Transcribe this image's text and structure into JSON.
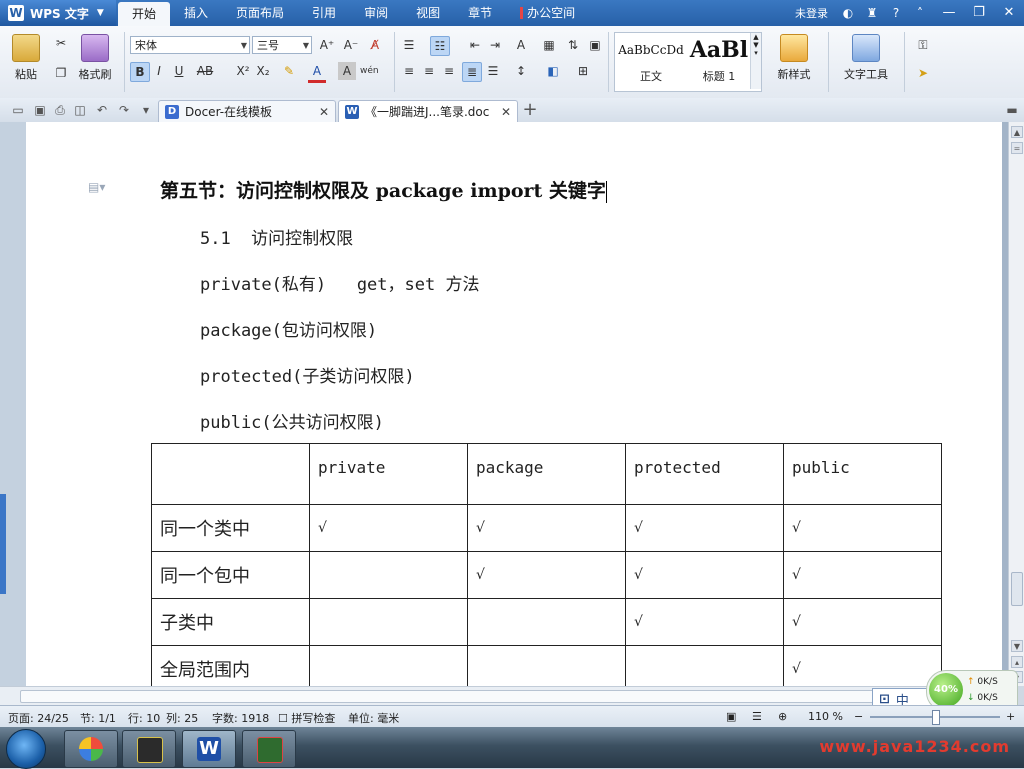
{
  "titlebar": {
    "app_name": "WPS 文字",
    "menu_tabs": [
      "开始",
      "插入",
      "页面布局",
      "引用",
      "审阅",
      "视图",
      "章节",
      "办公空间"
    ],
    "login": "未登录"
  },
  "ribbon": {
    "paste_label": "粘贴",
    "format_painter_label": "格式刷",
    "font_name": "宋体",
    "font_size": "三号",
    "styles": [
      {
        "preview": "AaBbCcDd",
        "name": "正文"
      },
      {
        "preview": "AaBl",
        "name": "标题 1"
      }
    ],
    "new_style_label": "新样式",
    "text_tools_label": "文字工具"
  },
  "tabs": [
    {
      "label": "Docer-在线模板"
    },
    {
      "label": "《一脚踹进J...笔录.doc"
    }
  ],
  "document": {
    "heading": "第五节：访问控制权限及 package import 关键字",
    "lines": [
      "5.1  访问控制权限",
      "private(私有)   get，set 方法",
      "package(包访问权限)",
      "protected(子类访问权限)",
      "public(公共访问权限)"
    ],
    "table": {
      "headers": [
        "",
        "private",
        "package",
        "protected",
        "public"
      ],
      "rows": [
        {
          "label": "同一个类中",
          "cells": [
            "√",
            "√",
            "√",
            "√"
          ]
        },
        {
          "label": "同一个包中",
          "cells": [
            "",
            "√",
            "√",
            "√"
          ]
        },
        {
          "label": "子类中",
          "cells": [
            "",
            "",
            "√",
            "√"
          ]
        },
        {
          "label": "全局范围内",
          "cells": [
            "",
            "",
            "",
            "√"
          ]
        }
      ]
    }
  },
  "widgets": {
    "ime_label": "中",
    "net_percent": "40%",
    "net_up": "0K/S",
    "net_down": "0K/S"
  },
  "statusbar": {
    "page": "页面: 24/25",
    "section": "节: 1/1",
    "row": "行: 10",
    "col": "列: 25",
    "word_count": "字数: 1918",
    "spell_check": "拼写检查",
    "unit": "单位: 毫米",
    "zoom": "110 %"
  },
  "taskbar": {
    "watermark": "www.java1234.com"
  },
  "colors": {
    "titlebar": "#2760a8",
    "accent": "#3b76c7",
    "watermark": "#e23b2f"
  }
}
